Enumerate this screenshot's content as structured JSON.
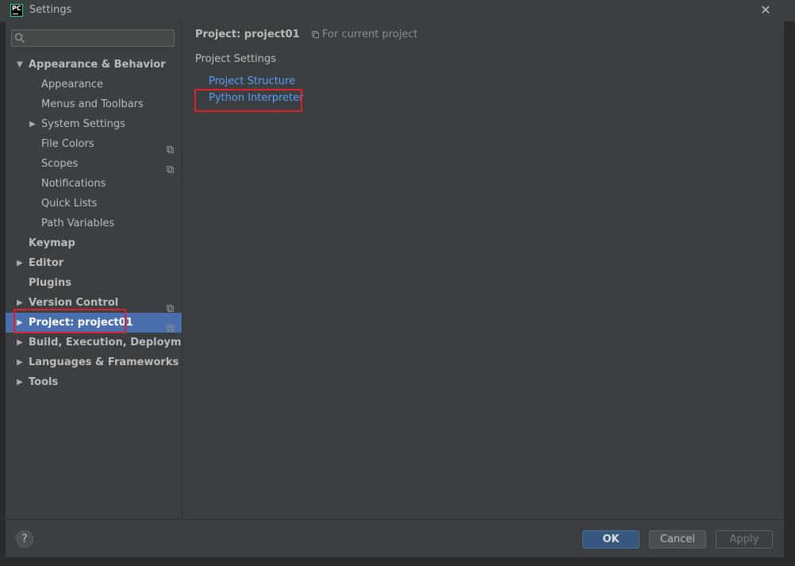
{
  "window": {
    "title": "Settings",
    "app_icon_text": "PC",
    "close_glyph": "✕"
  },
  "search": {
    "value": "",
    "placeholder": ""
  },
  "tree": [
    {
      "label": "Appearance & Behavior",
      "level": 0,
      "arrow": "expanded",
      "bold": true
    },
    {
      "label": "Appearance",
      "level": 1
    },
    {
      "label": "Menus and Toolbars",
      "level": 1
    },
    {
      "label": "System Settings",
      "level": 1,
      "arrow": "collapsed"
    },
    {
      "label": "File Colors",
      "level": 1,
      "project_icon": true
    },
    {
      "label": "Scopes",
      "level": 1,
      "project_icon": true
    },
    {
      "label": "Notifications",
      "level": 1
    },
    {
      "label": "Quick Lists",
      "level": 1
    },
    {
      "label": "Path Variables",
      "level": 1
    },
    {
      "label": "Keymap",
      "level": 0,
      "bold": true
    },
    {
      "label": "Editor",
      "level": 0,
      "arrow": "collapsed",
      "bold": true
    },
    {
      "label": "Plugins",
      "level": 0,
      "bold": true
    },
    {
      "label": "Version Control",
      "level": 0,
      "arrow": "collapsed",
      "bold": true,
      "project_icon": true
    },
    {
      "label": "Project: project01",
      "level": 0,
      "arrow": "collapsed",
      "bold": true,
      "project_icon": true,
      "selected": true
    },
    {
      "label": "Build, Execution, Deployment",
      "level": 0,
      "arrow": "collapsed",
      "bold": true
    },
    {
      "label": "Languages & Frameworks",
      "level": 0,
      "arrow": "collapsed",
      "bold": true
    },
    {
      "label": "Tools",
      "level": 0,
      "arrow": "collapsed",
      "bold": true
    }
  ],
  "main": {
    "title": "Project: project01",
    "scope_note": "For current project",
    "section_title": "Project Settings",
    "links": [
      "Project Structure",
      "Python Interpreter"
    ]
  },
  "footer": {
    "help_label": "?",
    "ok_label": "OK",
    "cancel_label": "Cancel",
    "apply_label": "Apply"
  },
  "colors": {
    "background": "#3c3f41",
    "selection": "#4b6eaf",
    "link": "#589df6",
    "highlight_box": "#e0202a",
    "primary_button": "#365880"
  }
}
